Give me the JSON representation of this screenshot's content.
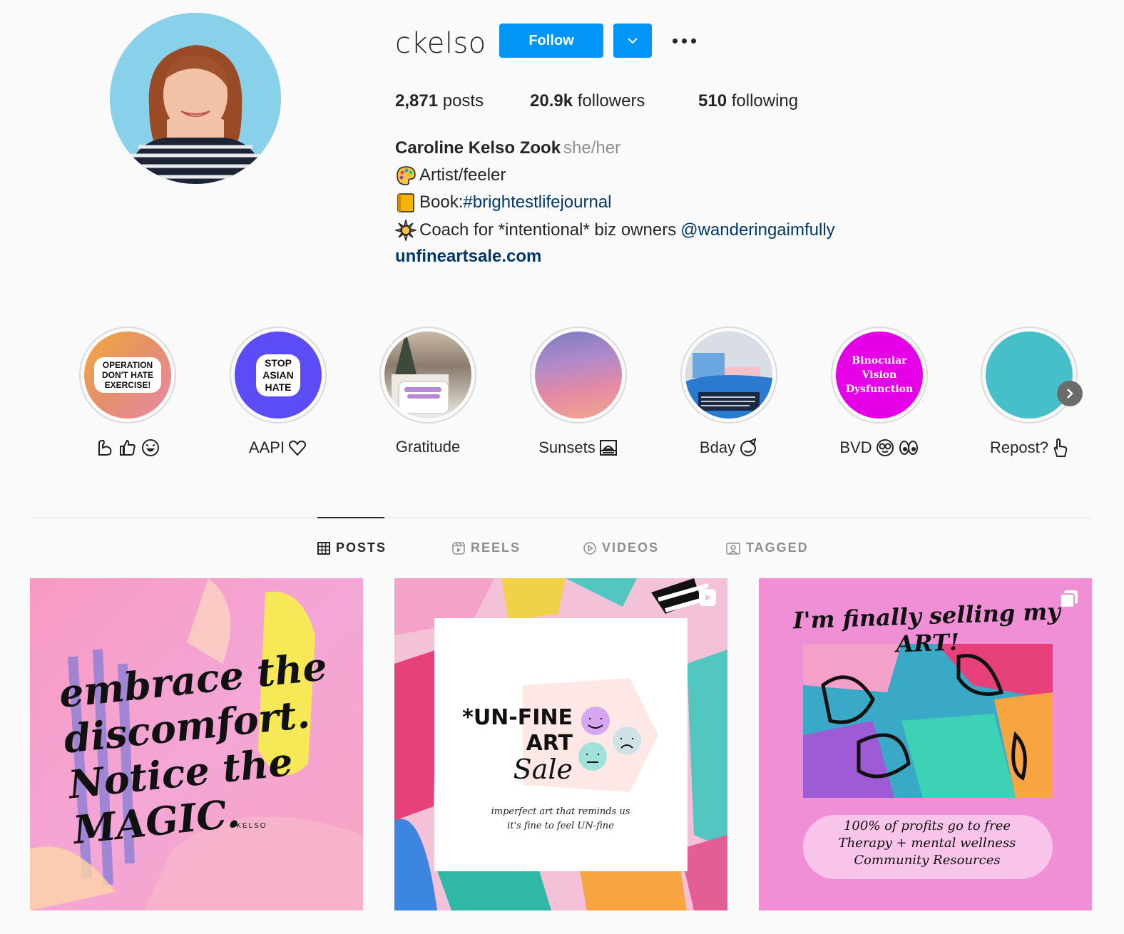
{
  "profile": {
    "username": "ckelso",
    "follow_label": "Follow",
    "stats": {
      "posts_count": "2,871",
      "posts_label": "posts",
      "followers_count": "20.9k",
      "followers_label": "followers",
      "following_count": "510",
      "following_label": "following"
    },
    "full_name": "Caroline Kelso Zook",
    "pronouns": "she/her",
    "bio": {
      "line1_text": "Artist/feeler",
      "line1_icon": "palette-emoji",
      "line2_text": "Book: ",
      "line2_link": "#brightestlifejournal",
      "line2_icon": "notebook-emoji",
      "line3_text": "Coach for *intentional* biz owners ",
      "line3_link": "@wanderingaimfully",
      "line3_icon": "sun-emoji"
    },
    "website": "unfineartsale.com"
  },
  "highlights": [
    {
      "label": "",
      "cover_text": "OPERATION DON'T HATE EXERCISE!",
      "label_icons": "muscle thumbs-up grin"
    },
    {
      "label": "AAPI",
      "cover_text": "STOP ASIAN HATE",
      "label_icons": "heart-hands"
    },
    {
      "label": "Gratitude",
      "cover_text": "",
      "label_icons": ""
    },
    {
      "label": "Sunsets",
      "cover_text": "",
      "label_icons": "sunset"
    },
    {
      "label": "Bday",
      "cover_text": "",
      "label_icons": "party-face"
    },
    {
      "label": "BVD",
      "cover_text": "Binocular Vision Dysfunction",
      "label_icons": "glasses eyes"
    },
    {
      "label": "Repost?",
      "cover_text": "",
      "label_icons": "pointing-hand"
    }
  ],
  "tabs": [
    {
      "label": "POSTS",
      "icon": "grid-icon",
      "active": true
    },
    {
      "label": "REELS",
      "icon": "reels-icon",
      "active": false
    },
    {
      "label": "VIDEOS",
      "icon": "play-icon",
      "active": false
    },
    {
      "label": "TAGGED",
      "icon": "tagged-icon",
      "active": false
    }
  ],
  "posts": [
    {
      "text": "embrace the discomfort. Notice the MAGIC.",
      "signature": "CKELSO"
    },
    {
      "title_line1": "*UN-FINE",
      "title_line2": "ART",
      "title_line3": "Sale",
      "caption": "imperfect art that reminds us it's fine to feel UN-fine",
      "type_icon": "reel-icon"
    },
    {
      "headline": "I'm finally selling my ART!",
      "footer": "100% of profits go to free Therapy + mental wellness Community Resources",
      "type_icon": "carousel-icon"
    }
  ],
  "colors": {
    "accent": "#0095f6",
    "link": "#00376b",
    "text": "#262626",
    "muted": "#8e8e8e",
    "background": "#fafafa"
  }
}
